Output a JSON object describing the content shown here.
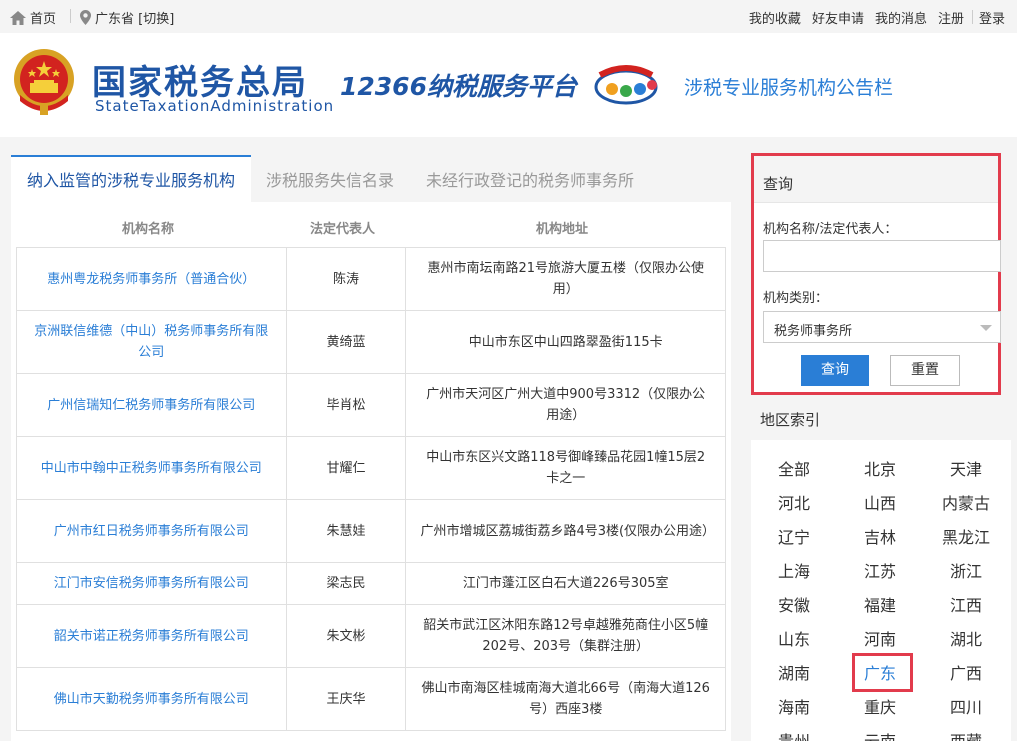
{
  "topbar": {
    "home": "首页",
    "location": "广东省 [切换]",
    "links": [
      "我的收藏",
      "好友申请",
      "我的消息",
      "注册",
      "登录"
    ]
  },
  "header": {
    "logo_cn": "国家税务总局",
    "logo_en": "StateTaxationAdministration",
    "platform": "12366纳税服务平台",
    "board_title": "涉税专业服务机构公告栏"
  },
  "tabs": [
    "纳入监管的涉税专业服务机构",
    "涉税服务失信名录",
    "未经行政登记的税务师事务所"
  ],
  "table": {
    "headers": [
      "机构名称",
      "法定代表人",
      "机构地址"
    ],
    "rows": [
      {
        "name": "惠州粤龙税务师事务所（普通合伙）",
        "rep": "陈涛",
        "addr": "惠州市南坛南路21号旅游大厦五楼（仅限办公使用）"
      },
      {
        "name": "京洲联信维德（中山）税务师事务所有限公司",
        "rep": "黄绮蓝",
        "addr": "中山市东区中山四路翠盈街115卡"
      },
      {
        "name": "广州信瑞知仁税务师事务所有限公司",
        "rep": "毕肖松",
        "addr": "广州市天河区广州大道中900号3312（仅限办公用途）"
      },
      {
        "name": "中山市中翰中正税务师事务所有限公司",
        "rep": "甘耀仁",
        "addr": "中山市东区兴文路118号御峰臻品花园1幢15层2卡之一"
      },
      {
        "name": "广州市红日税务师事务所有限公司",
        "rep": "朱慧娃",
        "addr": "广州市增城区荔城街荔乡路4号3楼(仅限办公用途）"
      },
      {
        "name": "江门市安信税务师事务所有限公司",
        "rep": "梁志民",
        "addr": "江门市蓬江区白石大道226号305室"
      },
      {
        "name": "韶关市诺正税务师事务所有限公司",
        "rep": "朱文彬",
        "addr": "韶关市武江区沐阳东路12号卓越雅苑商住小区5幢202号、203号（集群注册）"
      },
      {
        "name": "佛山市天勤税务师事务所有限公司",
        "rep": "王庆华",
        "addr": "佛山市南海区桂城南海大道北66号（南海大道126号）西座3楼"
      }
    ]
  },
  "query": {
    "title": "查询",
    "name_label": "机构名称/法定代表人：",
    "name_value": "",
    "type_label": "机构类别：",
    "type_value": "税务师事务所",
    "search_button": "查询",
    "reset_button": "重置"
  },
  "region": {
    "title": "地区索引",
    "items": [
      "全部",
      "北京",
      "天津",
      "河北",
      "山西",
      "内蒙古",
      "辽宁",
      "吉林",
      "黑龙江",
      "上海",
      "江苏",
      "浙江",
      "安徽",
      "福建",
      "江西",
      "山东",
      "河南",
      "湖北",
      "湖南",
      "广东",
      "广西",
      "海南",
      "重庆",
      "四川",
      "贵州",
      "云南",
      "西藏"
    ],
    "selected": "广东"
  }
}
